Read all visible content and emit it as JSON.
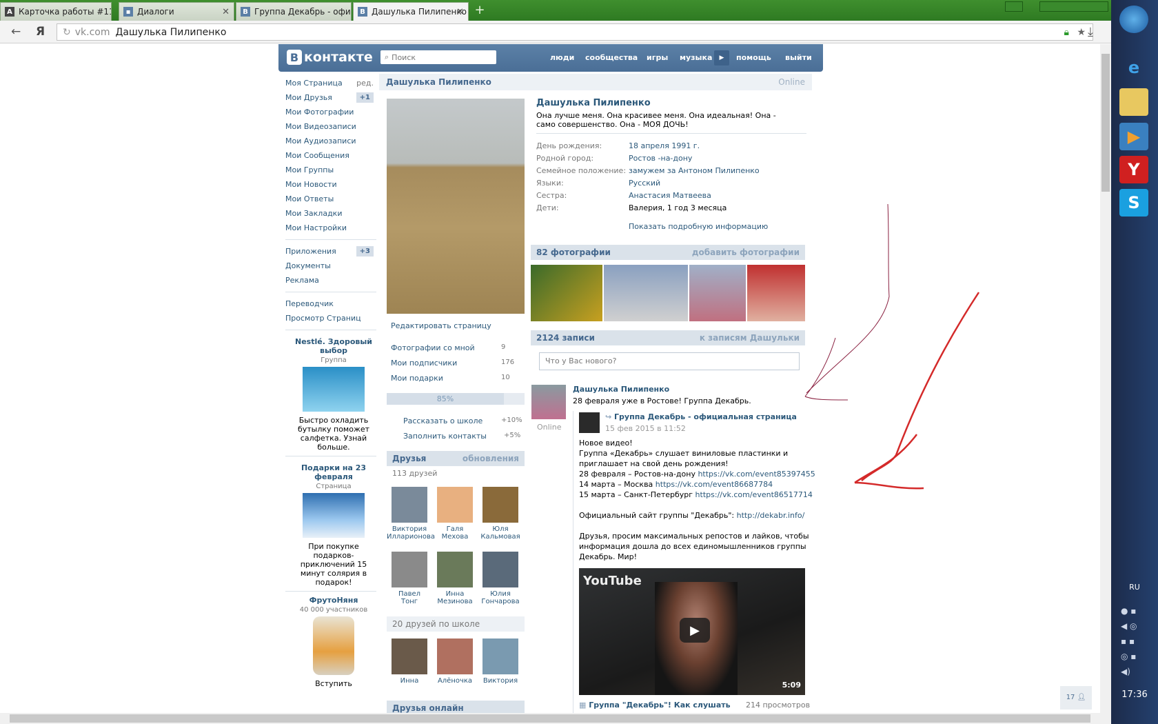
{
  "browser": {
    "tabs": [
      {
        "label": "Карточка работы #11(",
        "icon": "document-icon"
      },
      {
        "label": "Диалоги",
        "icon": "vk-messages-icon"
      },
      {
        "label": "Группа Декабрь - офи",
        "icon": "vk-icon"
      },
      {
        "label": "Дашулька Пилипенко",
        "icon": "vk-icon"
      }
    ],
    "host": "vk.com",
    "page_title": "Дашулька Пилипенко"
  },
  "taskbar": {
    "lang": "RU",
    "time": "17:36"
  },
  "vk": {
    "logo": "контакте",
    "logo_b": "В",
    "search_placeholder": "Поиск",
    "nav": [
      "люди",
      "сообщества",
      "игры",
      "музыка",
      "помощь",
      "выйти"
    ],
    "menu": [
      {
        "label": "Моя Страница",
        "extra": "ред."
      },
      {
        "label": "Мои Друзья",
        "badge": "+1"
      },
      {
        "label": "Мои Фотографии"
      },
      {
        "label": "Мои Видеозаписи"
      },
      {
        "label": "Мои Аудиозаписи"
      },
      {
        "label": "Мои Сообщения"
      },
      {
        "label": "Мои Группы"
      },
      {
        "label": "Мои Новости"
      },
      {
        "label": "Мои Ответы"
      },
      {
        "label": "Мои Закладки"
      },
      {
        "label": "Мои Настройки"
      }
    ],
    "menu2": [
      {
        "label": "Приложения",
        "badge": "+3"
      },
      {
        "label": "Документы"
      },
      {
        "label": "Реклама"
      }
    ],
    "menu3": [
      {
        "label": "Переводчик"
      },
      {
        "label": "Просмотр Страниц"
      }
    ],
    "ads": [
      {
        "title": "Nestlé. Здоровый выбор",
        "sub": "Группа",
        "desc": "Быстро охладить бутылку поможет салфетка. Узнай больше."
      },
      {
        "title": "Подарки на 23 февраля",
        "sub": "Страница",
        "desc": "При покупке подарков-приключений 15 минут солярия в подарок!"
      },
      {
        "title": "ФрутоНяня",
        "sub": "40 000 участников",
        "desc": "Вступить"
      }
    ]
  },
  "profile": {
    "name": "Дашулька Пилипенко",
    "online": "Online",
    "status": "Она лучше меня. Она красивее меня. Она идеальная! Она - само совершенство. Она - МОЯ ДОЧЬ!",
    "info": [
      {
        "k": "День рождения:",
        "v": "18 апреля 1991 г."
      },
      {
        "k": "Родной город:",
        "v": "Ростов -на-дону"
      },
      {
        "k": "Семейное положение:",
        "v": "замужем за Антоном Пилипенко"
      },
      {
        "k": "Языки:",
        "v": "Русский"
      },
      {
        "k": "Сестра:",
        "v": "Анастасия Матвеева"
      },
      {
        "k": "Дети:",
        "v": "Валерия, 1 год 3 месяца"
      }
    ],
    "more_info": "Показать подробную информацию",
    "edit": "Редактировать страницу",
    "counters": [
      {
        "label": "Фотографии со мной",
        "count": "9"
      },
      {
        "label": "Мои подписчики",
        "count": "176"
      },
      {
        "label": "Мои подарки",
        "count": "10"
      }
    ],
    "completion": "85%",
    "completion_value": 0.85,
    "tasks": [
      {
        "label": "Рассказать о школе",
        "v": "+10%"
      },
      {
        "label": "Заполнить контакты",
        "v": "+5%"
      }
    ],
    "friends_head": "Друзья",
    "friends_updates": "обновления",
    "friends_count": "113 друзей",
    "friends": [
      {
        "n": "Виктория",
        "s": "Илларионова"
      },
      {
        "n": "Галя",
        "s": "Мехова"
      },
      {
        "n": "Юля",
        "s": "Кальмовая"
      },
      {
        "n": "Павел",
        "s": "Тонг"
      },
      {
        "n": "Инна",
        "s": "Мезинова"
      },
      {
        "n": "Юлия",
        "s": "Гончарова"
      }
    ],
    "school_head": "20 друзей по школе",
    "school": [
      {
        "n": "Инна"
      },
      {
        "n": "Алёночка"
      },
      {
        "n": "Виктория"
      }
    ],
    "online_head": "Друзья онлайн",
    "photos_head": "82 фотографии",
    "photos_add": "добавить фотографии",
    "wall_head": "2124 записи",
    "wall_link": "к записям Дашульки",
    "whatnew": "Что у Вас нового?"
  },
  "post": {
    "author": "Дашулька Пилипенко",
    "author_status": "Online",
    "text": "28 февраля уже в Ростове! Группа Декабрь.",
    "repost_from": "Группа Декабрь - официальная страница",
    "repost_date": "15 фев 2015 в 11:52",
    "lines": [
      "Новое видео!",
      "Группа «Декабрь» слушает виниловые пластинки и",
      "приглашает на свой день рождения!"
    ],
    "events": [
      {
        "t": "28 февраля – Ростов-на-дону ",
        "u": "https://vk.com/event85397455"
      },
      {
        "t": "14 марта – Москва ",
        "u": "https://vk.com/event86687784"
      },
      {
        "t": "15 марта – Санкт-Петербург ",
        "u": "https://vk.com/event86517714"
      }
    ],
    "site_text": "Официальный сайт группы \"Декабрь\": ",
    "site_url": "http://dekabr.info/",
    "ask": [
      "Друзья, просим максимальных репостов и лайков, чтобы",
      "информация дошла до всех единомышленников группы",
      "Декабрь. Мир!"
    ],
    "video_brand": "YouTube",
    "video_time": "5:09",
    "video_title": "Группа \"Декабрь\"! Как слушать",
    "video_views": "214 просмотров"
  },
  "counter_badge": "17"
}
